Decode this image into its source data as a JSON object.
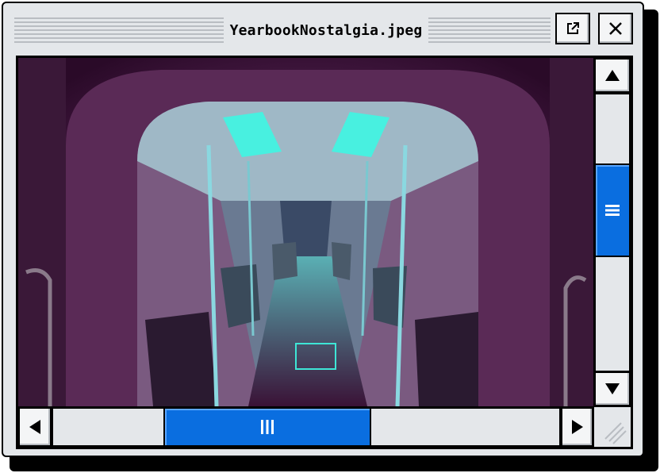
{
  "window": {
    "title": "YearbookNostalgia.jpeg"
  },
  "colors": {
    "accent": "#0a6ee0",
    "chrome": "#e4e7ea",
    "image_tint_dark": "#3a1236",
    "image_tint_light": "#3ee6d6"
  },
  "icons": {
    "popout": "popout-icon",
    "close": "close-icon",
    "scroll_up": "arrow-up-icon",
    "scroll_down": "arrow-down-icon",
    "scroll_left": "arrow-left-icon",
    "scroll_right": "arrow-right-icon",
    "resize": "resize-grip-icon"
  },
  "scroll": {
    "vertical_position": 0.38,
    "horizontal_position": 0.37
  }
}
